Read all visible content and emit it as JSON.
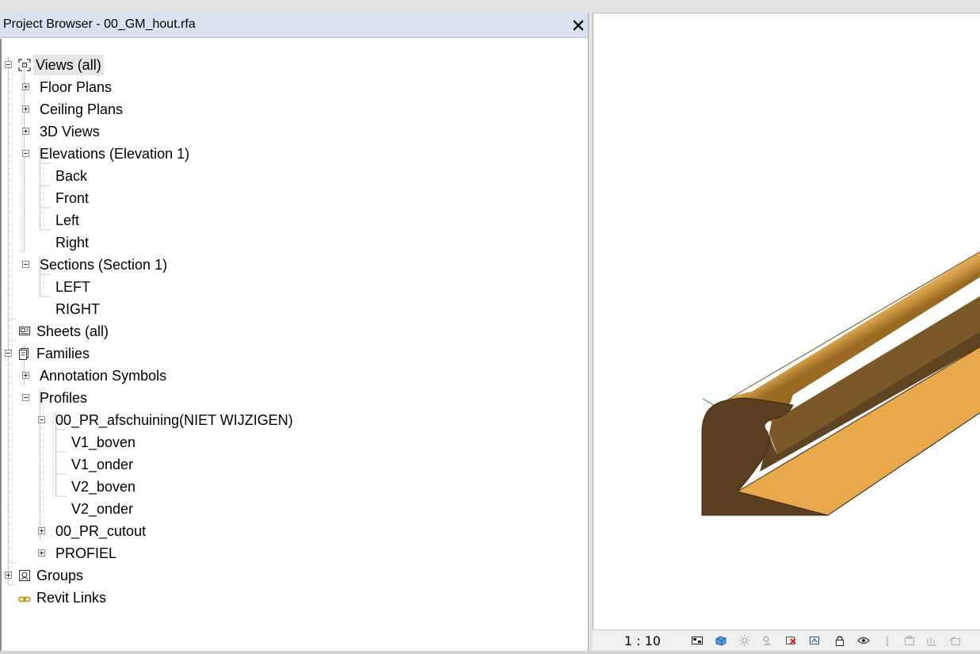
{
  "browser": {
    "title": "Project Browser - 00_GM_hout.rfa",
    "tree": {
      "views_all": "Views (all)",
      "floor_plans": "Floor Plans",
      "ceiling_plans": "Ceiling Plans",
      "views_3d": "3D Views",
      "elevations": "Elevations (Elevation 1)",
      "elev_back": "Back",
      "elev_front": "Front",
      "elev_left": "Left",
      "elev_right": "Right",
      "sections": "Sections (Section 1)",
      "sect_left": "LEFT",
      "sect_right": "RIGHT",
      "sheets_all": "Sheets (all)",
      "families": "Families",
      "annotation_symbols": "Annotation Symbols",
      "profiles": "Profiles",
      "pr_afschuining": "00_PR_afschuining(NIET WIJZIGEN)",
      "v1_boven": "V1_boven",
      "v1_onder": "V1_onder",
      "v2_boven": "V2_boven",
      "v2_onder": "V2_onder",
      "pr_cutout": "00_PR_cutout",
      "profiel": "PROFIEL",
      "groups": "Groups",
      "revit_links": "Revit Links"
    }
  },
  "statusbar": {
    "scale": "1 : 10"
  },
  "colors": {
    "wood_light": "#e8a94c",
    "wood_mid": "#b47e2e",
    "wood_dark": "#5a4020",
    "titlebar": "#d9e3ef",
    "selection": "#e5e5e5"
  }
}
